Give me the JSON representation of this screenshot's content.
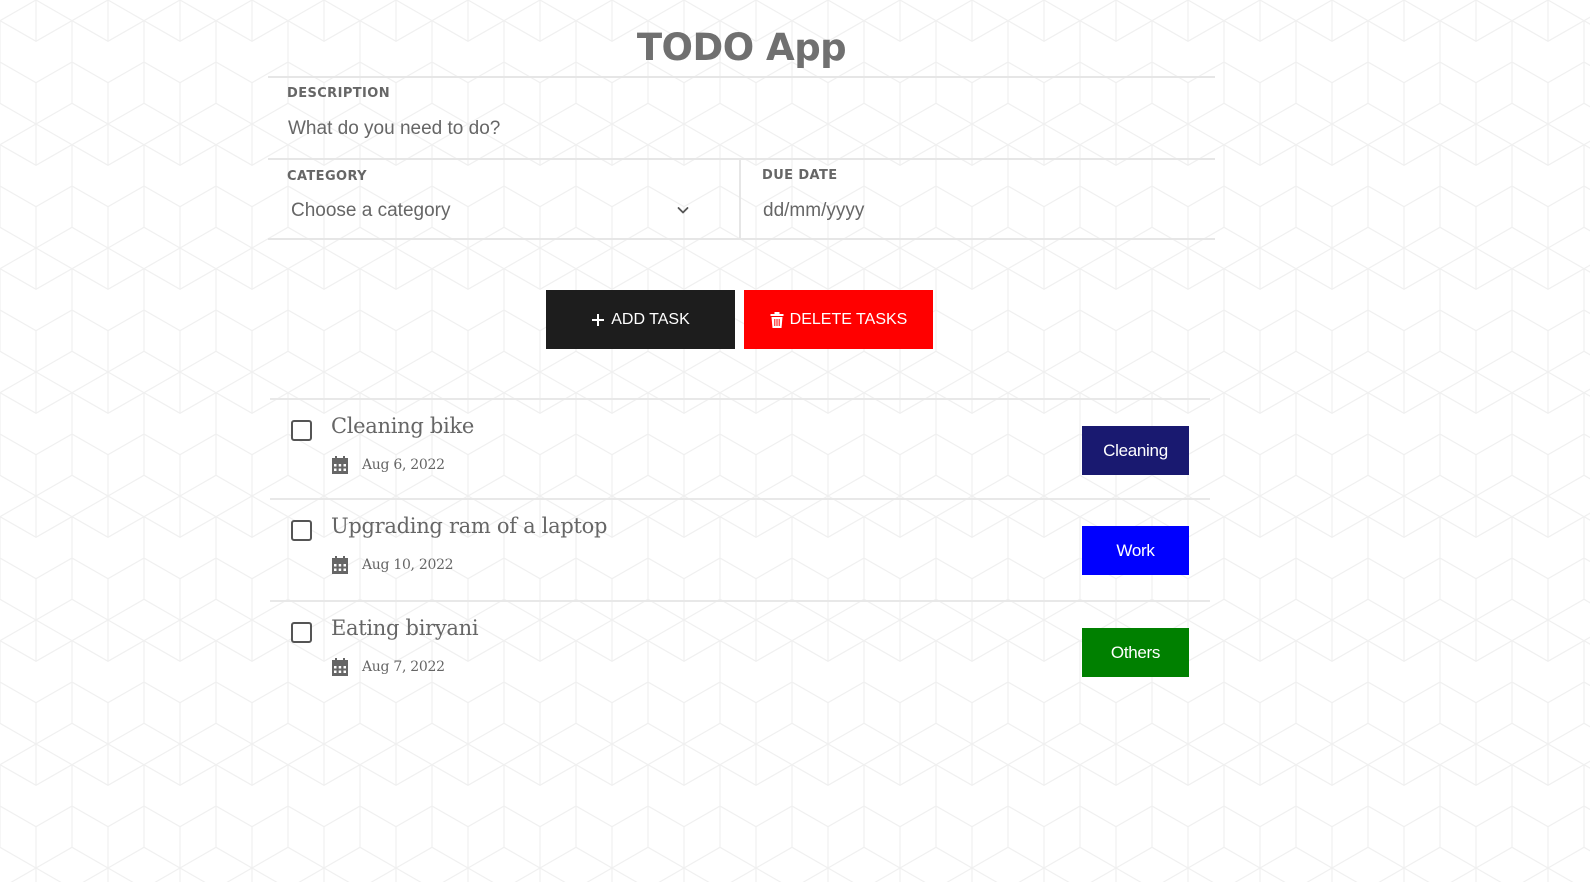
{
  "app": {
    "title": "TODO App"
  },
  "form": {
    "description_label": "DESCRIPTION",
    "description_placeholder": "What do you need to do?",
    "category_label": "CATEGORY",
    "category_value": "Choose a category",
    "due_date_label": "DUE DATE",
    "due_date_value": "dd/mm/yyyy"
  },
  "actions": {
    "add_label": "ADD TASK",
    "delete_label": "DELETE TASKS"
  },
  "tasks": [
    {
      "title": "Cleaning bike",
      "date": "Aug 6, 2022",
      "category": "Cleaning",
      "category_color": "#191970",
      "checked": false
    },
    {
      "title": "Upgrading ram of a laptop",
      "date": "Aug 10, 2022",
      "category": "Work",
      "category_color": "#0000ff",
      "checked": false
    },
    {
      "title": "Eating biryani",
      "date": "Aug 7, 2022",
      "category": "Others",
      "category_color": "#008000",
      "checked": false
    }
  ],
  "colors": {
    "add_button": "#1d1d1d",
    "delete_button": "#ff0000",
    "title_text": "#707070"
  },
  "icons": {
    "add": "plus-icon",
    "delete": "trash-icon",
    "date": "calendar-icon",
    "select": "chevron-down-icon"
  }
}
